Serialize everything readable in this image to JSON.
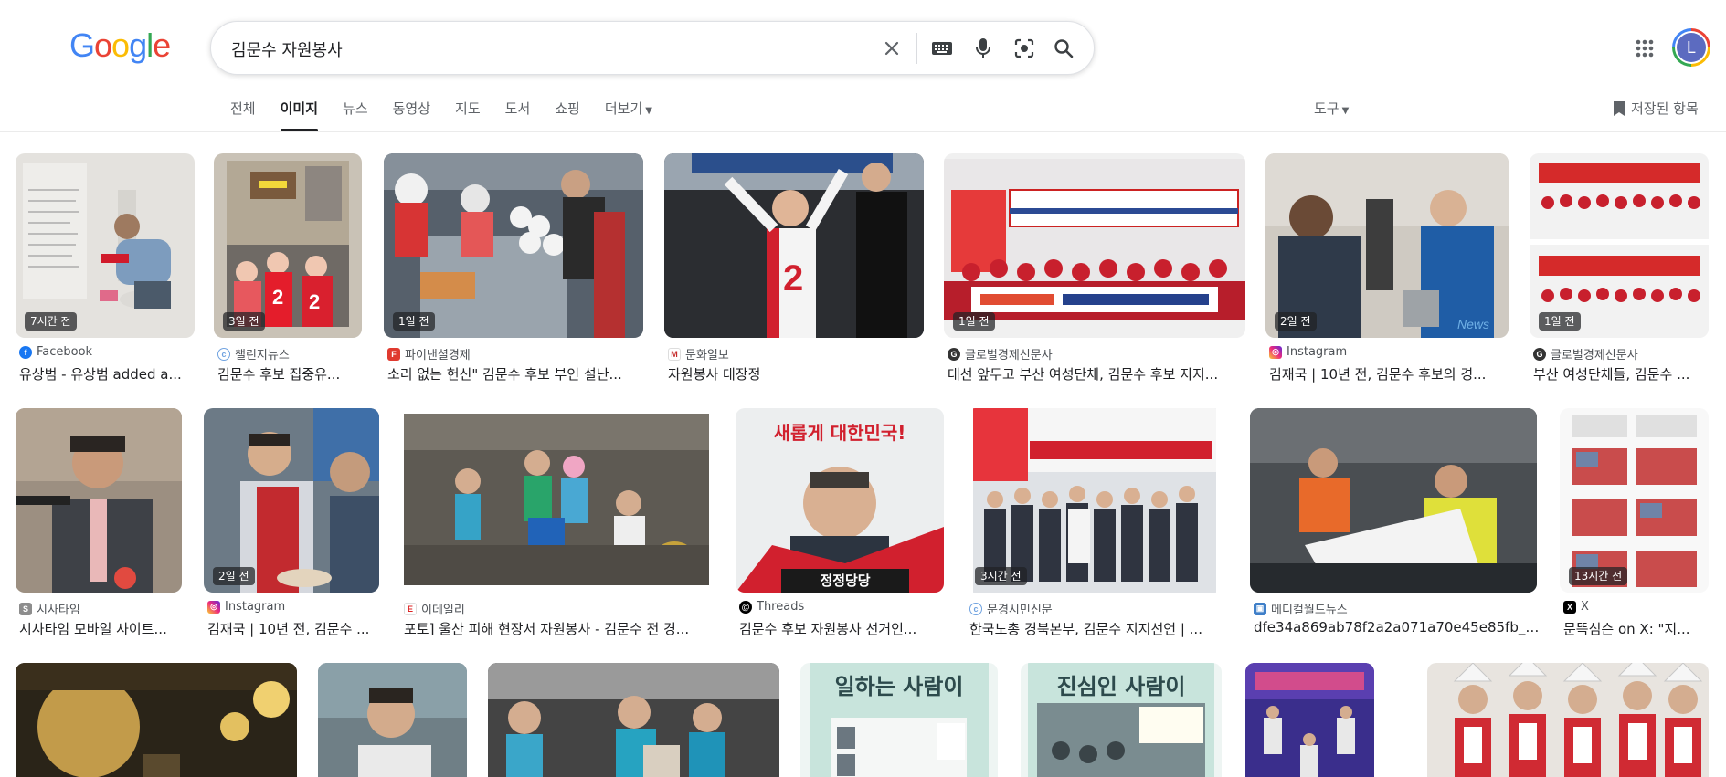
{
  "search": {
    "query": "김문수  자원봉사"
  },
  "logo": [
    "G",
    "o",
    "o",
    "g",
    "l",
    "e"
  ],
  "tabs": {
    "all": "전체",
    "images": "이미지",
    "news": "뉴스",
    "videos": "동영상",
    "maps": "지도",
    "books": "도서",
    "shopping": "쇼핑",
    "more": "더보기"
  },
  "tools": "도구",
  "saved": "저장된 항목",
  "avatar_letter": "L",
  "results": [
    {
      "time": "7시간 전",
      "source": "Facebook",
      "title": "유상범 - 유상범 added a..."
    },
    {
      "time": "3일 전",
      "source": "챌린지뉴스",
      "title": "김문수 후보 집중유..."
    },
    {
      "time": "1일 전",
      "source": "파이낸셜경제",
      "title": "소리 없는 헌신\" 김문수 후보 부인 설난..."
    },
    {
      "time": "",
      "source": "문화일보",
      "title": "자원봉사 대장정"
    },
    {
      "time": "1일 전",
      "source": "글로벌경제신문사",
      "title": "대선 앞두고 부산 여성단체, 김문수 후보 지지..."
    },
    {
      "time": "2일 전",
      "source": "Instagram",
      "title": "김재국 | 10년 전, 김문수 후보의 경..."
    },
    {
      "time": "1일 전",
      "source": "글로벌경제신문사",
      "title": "부산 여성단체들, 김문수 ..."
    },
    {
      "time": "",
      "source": "시사타임",
      "title": "시사타임 모바일 사이트..."
    },
    {
      "time": "2일 전",
      "source": "Instagram",
      "title": "김재국 | 10년 전, 김문수 ..."
    },
    {
      "time": "",
      "source": "이데일리",
      "title": "포토] 울산 피해 현장서 자원봉사 - 김문수 전 경..."
    },
    {
      "time": "",
      "source": "Threads",
      "title": "김문수 후보 자원봉사 선거인..."
    },
    {
      "time": "3시간 전",
      "source": "문경시민신문",
      "title": "한국노총 경북본부, 김문수 지지선언 | ..."
    },
    {
      "time": "",
      "source": "메디컬월드뉴스",
      "title": "dfe34a869ab78f2a2a071a70e45e85fb_8..."
    },
    {
      "time": "13시간 전",
      "source": "X",
      "title": "문뜩심슨 on X: \"지..."
    }
  ],
  "image_text": {
    "poster_brand": "새롭게 대한민국!",
    "poster_slogan": "정정당당",
    "row3_sign1": "일하는 사람이",
    "row3_sign2": "진심인 사람이"
  }
}
